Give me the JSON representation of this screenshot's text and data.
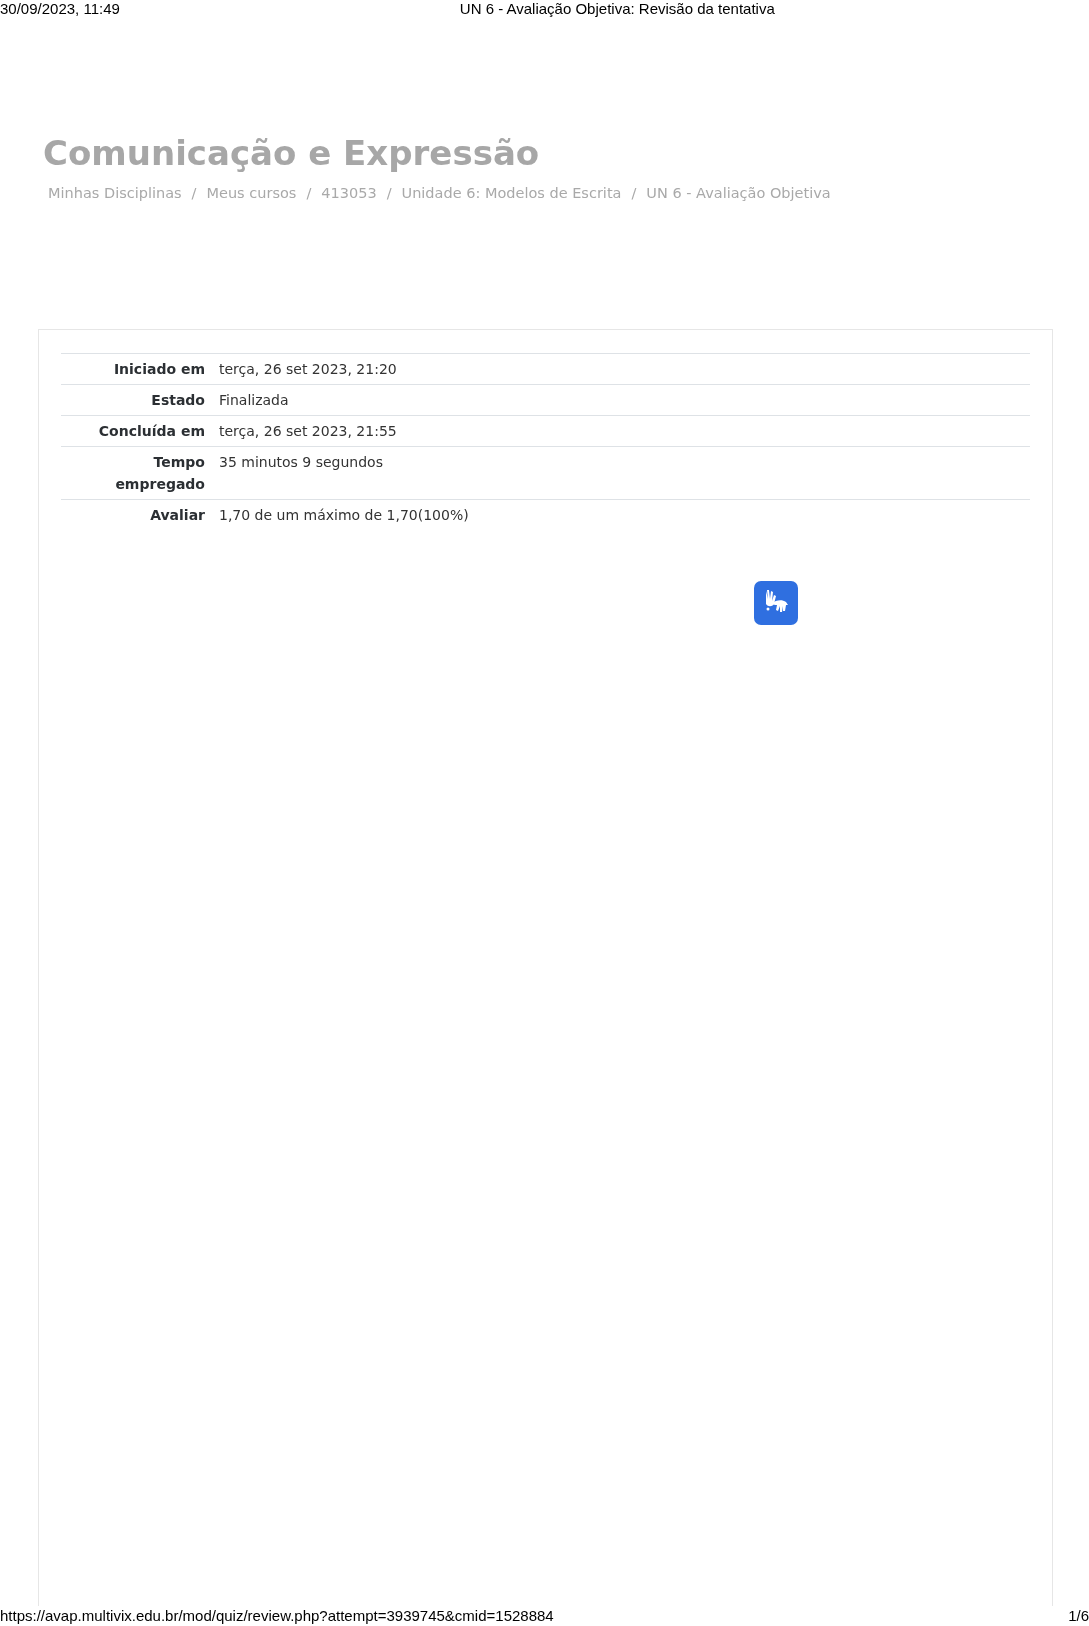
{
  "print_header": {
    "datetime": "30/09/2023, 11:49",
    "title": "UN 6 - Avaliação Objetiva: Revisão da tentativa"
  },
  "page_title": "Comunicação e Expressão",
  "breadcrumb": {
    "items": [
      {
        "label": "Minhas Disciplinas"
      },
      {
        "label": "Meus cursos"
      },
      {
        "label": "413053"
      },
      {
        "label": "Unidade 6: Modelos de Escrita"
      },
      {
        "label": "UN 6 - Avaliação Objetiva"
      }
    ],
    "separators": [
      "/",
      "/",
      "/",
      "/"
    ]
  },
  "summary": [
    {
      "label": "Iniciado em",
      "value": "terça, 26 set 2023, 21:20"
    },
    {
      "label": "Estado",
      "value": "Finalizada"
    },
    {
      "label": "Concluída em",
      "value": "terça, 26 set 2023, 21:55"
    },
    {
      "label": "Tempo empregado",
      "value": "35 minutos 9 segundos"
    },
    {
      "label": "Avaliar",
      "value": "1,70 de um máximo de 1,70(100%)"
    }
  ],
  "print_footer": {
    "url": "https://avap.multivix.edu.br/mod/quiz/review.php?attempt=3939745&cmid=1528884",
    "page": "1/6"
  }
}
